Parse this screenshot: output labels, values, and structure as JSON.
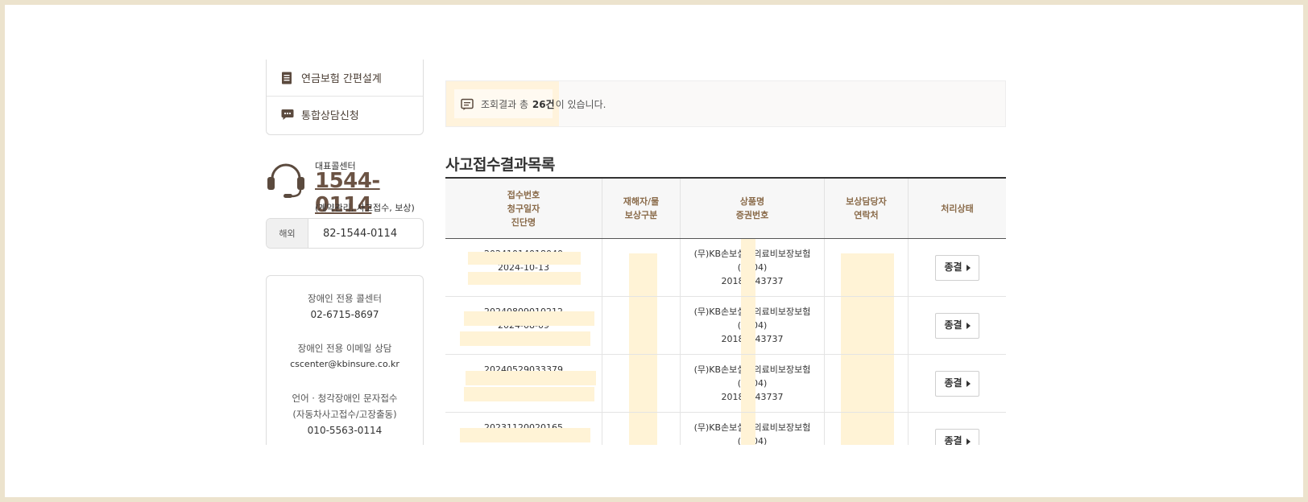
{
  "sidebar": {
    "menu": [
      {
        "label": "연금보험 간편설계",
        "icon": "document-icon"
      },
      {
        "label": "통합상담신청",
        "icon": "chat-bubble-icon"
      }
    ],
    "callcenter": {
      "label": "대표콜센터",
      "number": "1544-0114",
      "sub": "(계약관리, 사고접수, 보상)"
    },
    "overseas": {
      "tag": "해외",
      "number": "82-1544-0114"
    },
    "disabled": {
      "phone_title": "장애인 전용 콜센터",
      "phone": "02-6715-8697",
      "email_title": "장애인 전용 이메일 상담",
      "email": "cscenter@kbinsure.co.kr",
      "sms_title_1": "언어 · 청각장애인 문자접수",
      "sms_title_2": "(자동차사고접수/고장출동)",
      "sms": "010-5563-0114"
    }
  },
  "notice": {
    "prefix": "조회결과 총",
    "count": "26건",
    "suffix": "이 있습니다."
  },
  "section_title": "사고접수결과목록",
  "table": {
    "headers": [
      [
        "접수번호",
        "청구일자",
        "진단명"
      ],
      [
        "재해자/물",
        "보상구분"
      ],
      [
        "상품명",
        "증권번호"
      ],
      [
        "보상담당자",
        "연락처"
      ],
      [
        "처리상태"
      ]
    ],
    "rows": [
      {
        "receipt_no": "20241014018040",
        "date": "2024-10-13",
        "product": "(무)KB손보실손의료비보장보험",
        "product_sub": "(2004)",
        "policy_no": "20181343737",
        "status": "종결"
      },
      {
        "receipt_no": "20240809010212",
        "date": "2024-08-09",
        "product": "(무)KB손보실손의료비보장보험",
        "product_sub": "(2004)",
        "policy_no": "20181343737",
        "status": "종결"
      },
      {
        "receipt_no": "20240529033379",
        "date": "",
        "product": "(무)KB손보실손의료비보장보험",
        "product_sub": "(2004)",
        "policy_no": "20181343737",
        "status": "종결"
      },
      {
        "receipt_no": "20231120020165",
        "date": "",
        "product": "(무)KB손보실손의료비보장보험",
        "product_sub": "(2004)",
        "policy_no": "",
        "status": "종결"
      }
    ]
  },
  "colors": {
    "brand_brown": "#6b5344",
    "header_text": "#8a6b4a",
    "redaction": "#fff3d6",
    "frame": "#ece3cd"
  }
}
